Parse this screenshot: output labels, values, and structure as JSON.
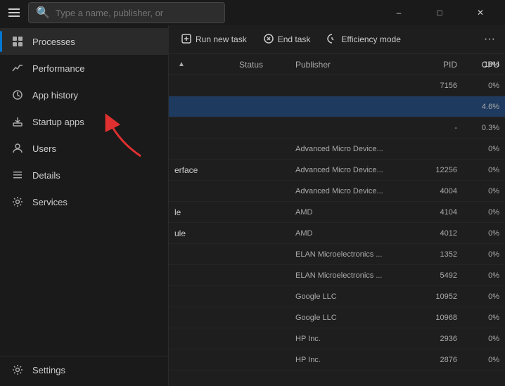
{
  "titlebar": {
    "search_placeholder": "Type a name, publisher, or",
    "minimize_label": "–",
    "maximize_label": "□",
    "close_label": "✕"
  },
  "sidebar": {
    "items": [
      {
        "id": "processes",
        "label": "Processes",
        "icon": "⊞",
        "active": true
      },
      {
        "id": "performance",
        "label": "Performance",
        "icon": "📈"
      },
      {
        "id": "app-history",
        "label": "App history",
        "icon": "🕐"
      },
      {
        "id": "startup-apps",
        "label": "Startup apps",
        "icon": "🚀"
      },
      {
        "id": "users",
        "label": "Users",
        "icon": "👤"
      },
      {
        "id": "details",
        "label": "Details",
        "icon": "≡"
      },
      {
        "id": "services",
        "label": "Services",
        "icon": "⚙"
      }
    ],
    "bottom_items": [
      {
        "id": "settings",
        "label": "Settings",
        "icon": "⚙"
      }
    ]
  },
  "toolbar": {
    "run_new_task": "Run new task",
    "end_task": "End task",
    "efficiency_mode": "Efficiency mode",
    "more_label": "···"
  },
  "table": {
    "columns": {
      "status": "Status",
      "publisher": "Publisher",
      "pid": "PID",
      "cpu": "CPU",
      "cpu_usage": "18%"
    },
    "rows": [
      {
        "name": "",
        "status": "",
        "publisher": "",
        "pid": "7156",
        "cpu": "0%",
        "highlighted": false
      },
      {
        "name": "",
        "status": "",
        "publisher": "",
        "pid": "",
        "cpu": "4.6%",
        "highlighted": true
      },
      {
        "name": "",
        "status": "",
        "publisher": "",
        "pid": "-",
        "cpu": "0.3%",
        "highlighted": false
      },
      {
        "name": "",
        "status": "",
        "publisher": "Advanced Micro Device...",
        "pid": "",
        "cpu": "0%",
        "highlighted": false
      },
      {
        "name": "erface",
        "status": "",
        "publisher": "Advanced Micro Device...",
        "pid": "12256",
        "cpu": "0%",
        "highlighted": false
      },
      {
        "name": "",
        "status": "",
        "publisher": "Advanced Micro Device...",
        "pid": "4004",
        "cpu": "0%",
        "highlighted": false
      },
      {
        "name": "le",
        "status": "",
        "publisher": "AMD",
        "pid": "4104",
        "cpu": "0%",
        "highlighted": false
      },
      {
        "name": "ule",
        "status": "",
        "publisher": "AMD",
        "pid": "4012",
        "cpu": "0%",
        "highlighted": false
      },
      {
        "name": "",
        "status": "",
        "publisher": "ELAN Microelectronics ...",
        "pid": "1352",
        "cpu": "0%",
        "highlighted": false
      },
      {
        "name": "",
        "status": "",
        "publisher": "ELAN Microelectronics ...",
        "pid": "5492",
        "cpu": "0%",
        "highlighted": false
      },
      {
        "name": "",
        "status": "",
        "publisher": "Google LLC",
        "pid": "10952",
        "cpu": "0%",
        "highlighted": false
      },
      {
        "name": "",
        "status": "",
        "publisher": "Google LLC",
        "pid": "10968",
        "cpu": "0%",
        "highlighted": false
      },
      {
        "name": "",
        "status": "",
        "publisher": "HP Inc.",
        "pid": "2936",
        "cpu": "0%",
        "highlighted": false
      },
      {
        "name": "",
        "status": "",
        "publisher": "HP Inc.",
        "pid": "2876",
        "cpu": "0%",
        "highlighted": false
      }
    ]
  }
}
